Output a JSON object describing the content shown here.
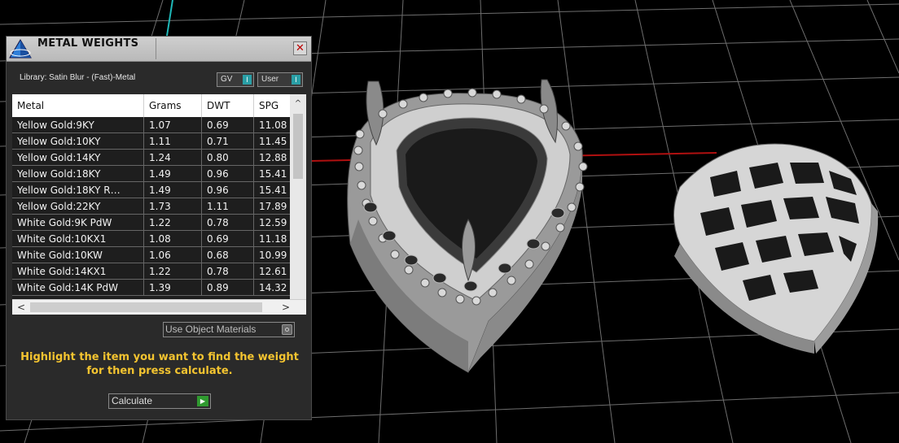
{
  "dialog": {
    "title": "METAL WEIGHTS",
    "close_icon": "close-icon",
    "library_label": "Library: Satin Blur - (Fast)-Metal",
    "toggles": [
      {
        "label": "GV",
        "state": "I"
      },
      {
        "label": "User",
        "state": "I"
      }
    ],
    "table": {
      "headers": [
        "Metal",
        "Grams",
        "DWT",
        "SPG"
      ],
      "rows": [
        [
          "Yellow Gold:9KY",
          "1.07",
          "0.69",
          "11.08"
        ],
        [
          "Yellow Gold:10KY",
          "1.11",
          "0.71",
          "11.45"
        ],
        [
          "Yellow Gold:14KY",
          "1.24",
          "0.80",
          "12.88"
        ],
        [
          "Yellow Gold:18KY",
          "1.49",
          "0.96",
          "15.41"
        ],
        [
          "Yellow Gold:18KY R…",
          "1.49",
          "0.96",
          "15.41"
        ],
        [
          "Yellow Gold:22KY",
          "1.73",
          "1.11",
          "17.89"
        ],
        [
          "White Gold:9K PdW",
          "1.22",
          "0.78",
          "12.59"
        ],
        [
          "White Gold:10KX1",
          "1.08",
          "0.69",
          "11.18"
        ],
        [
          "White Gold:10KW",
          "1.06",
          "0.68",
          "10.99"
        ],
        [
          "White Gold:14KX1",
          "1.22",
          "0.78",
          "12.61"
        ],
        [
          "White Gold:14K PdW",
          "1.39",
          "0.89",
          "14.32"
        ]
      ]
    },
    "use_object_materials_label": "Use Object Materials",
    "hint_line1": "Highlight the item you want to find the weight",
    "hint_line2": "for then press calculate.",
    "calculate_label": "Calculate",
    "accent_color": "#f4c430",
    "toggle_color": "#2a9fa6"
  }
}
